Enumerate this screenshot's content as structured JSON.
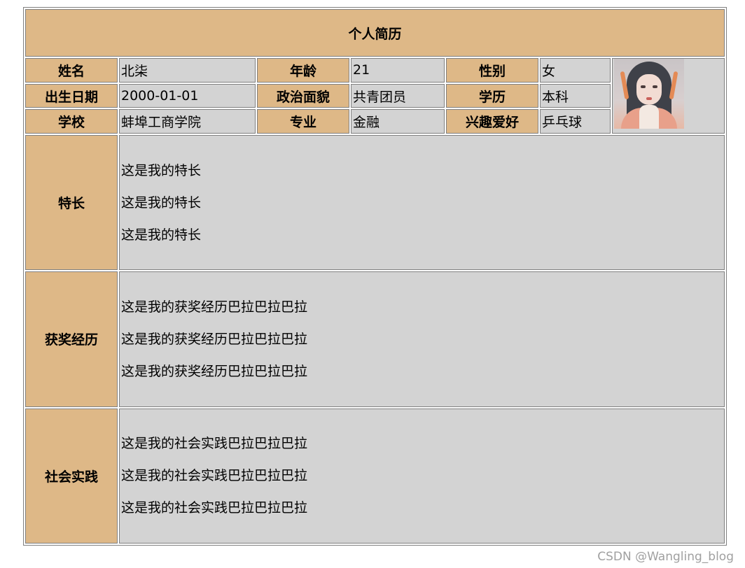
{
  "title": "个人简历",
  "info_rows": [
    [
      {
        "label": "姓名",
        "value": "北柒"
      },
      {
        "label": "年龄",
        "value": "21"
      },
      {
        "label": "性别",
        "value": "女"
      }
    ],
    [
      {
        "label": "出生日期",
        "value": "2000-01-01"
      },
      {
        "label": "政治面貌",
        "value": "共青团员"
      },
      {
        "label": "学历",
        "value": "本科"
      }
    ],
    [
      {
        "label": "学校",
        "value": "蚌埠工商学院"
      },
      {
        "label": "专业",
        "value": "金融"
      },
      {
        "label": "兴趣爱好",
        "value": "乒乓球"
      }
    ]
  ],
  "sections": [
    {
      "label": "特长",
      "lines": [
        "这是我的特长",
        "这是我的特长",
        "这是我的特长"
      ]
    },
    {
      "label": "获奖经历",
      "lines": [
        "这是我的获奖经历巴拉巴拉巴拉",
        "这是我的获奖经历巴拉巴拉巴拉",
        "这是我的获奖经历巴拉巴拉巴拉"
      ]
    },
    {
      "label": "社会实践",
      "lines": [
        "这是我的社会实践巴拉巴拉巴拉",
        "这是我的社会实践巴拉巴拉巴拉",
        "这是我的社会实践巴拉巴拉巴拉"
      ]
    }
  ],
  "photo_icon": "portrait-photo",
  "colors": {
    "header_bg": "#deb887",
    "value_bg": "#d3d3d3",
    "border": "#808080"
  },
  "watermark": "CSDN @Wangling_blog"
}
